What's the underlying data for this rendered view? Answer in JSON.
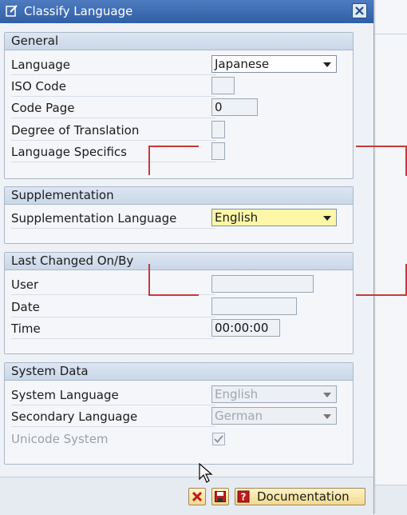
{
  "window": {
    "title": "Classify Language"
  },
  "groups": {
    "general": {
      "title": "General",
      "language": {
        "label": "Language",
        "value": "Japanese"
      },
      "iso_code": {
        "label": "ISO Code",
        "value": ""
      },
      "code_page": {
        "label": "Code Page",
        "value": "0"
      },
      "degree_translation": {
        "label": "Degree of Translation",
        "value": ""
      },
      "language_specifics": {
        "label": "Language Specifics",
        "value": ""
      }
    },
    "supplementation": {
      "title": "Supplementation",
      "supp_language": {
        "label": "Supplementation Language",
        "value": "English"
      }
    },
    "last_changed": {
      "title": "Last Changed On/By",
      "user": {
        "label": "User",
        "value": ""
      },
      "date": {
        "label": "Date",
        "value": ""
      },
      "time": {
        "label": "Time",
        "value": "00:00:00"
      }
    },
    "system_data": {
      "title": "System Data",
      "system_language": {
        "label": "System Language",
        "value": "English"
      },
      "secondary_language": {
        "label": "Secondary Language",
        "value": "German"
      },
      "unicode_system": {
        "label": "Unicode System",
        "checked": true
      }
    }
  },
  "footer": {
    "documentation_label": "Documentation"
  },
  "colors": {
    "title_bar": "#2f5fa6",
    "annotation": "#c63a3a",
    "input_highlight": "#fff7a8"
  }
}
